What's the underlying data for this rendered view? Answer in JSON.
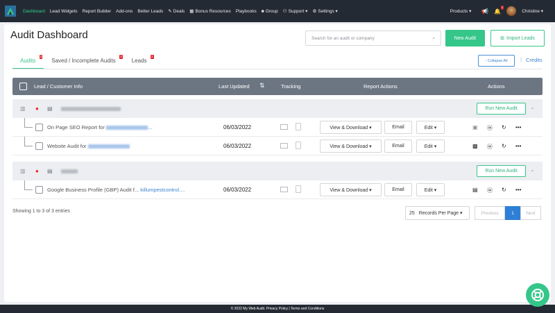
{
  "nav": {
    "items": [
      {
        "label": "Dashboard",
        "active": true
      },
      {
        "label": "Lead Widgets"
      },
      {
        "label": "Report Builder"
      },
      {
        "label": "Add-ons"
      },
      {
        "label": "Better Leads"
      },
      {
        "label": "Deals",
        "icon": "deals-icon"
      },
      {
        "label": "Bonus Resources",
        "icon": "bonus-icon"
      },
      {
        "label": "Playbooks"
      },
      {
        "label": "Group",
        "icon": "facebook-icon"
      },
      {
        "label": "Support ▾",
        "icon": "support-icon"
      },
      {
        "label": "Settings ▾",
        "icon": "gear-icon"
      }
    ],
    "products": "Products ▾",
    "notifications_count": "2",
    "user": "Christine ▾"
  },
  "page": {
    "title": "Audit Dashboard",
    "search_placeholder": "Search for an audit or company",
    "new_audit": "New Audit",
    "import_leads": "Import Leads",
    "collapse_all": "- Collapse All",
    "separator": "|",
    "credits": "Credits"
  },
  "tabs": [
    {
      "label": "Audits",
      "count": "3",
      "active": true
    },
    {
      "label": "Saved / Incomplete Audits",
      "count": "3"
    },
    {
      "label": "Leads",
      "count": "2"
    }
  ],
  "table": {
    "headers": {
      "info": "Lead / Customer Info",
      "updated": "Last Updated",
      "tracking": "Tracking",
      "report_actions": "Report Actions",
      "actions": "Actions"
    },
    "run_new_audit": "Run New Audit",
    "view_download": "View & Download ▾",
    "email": "Email",
    "edit": "Edit ▾",
    "rows": [
      {
        "name": "On Page SEO Report for",
        "link": "",
        "date": "06/03/2022"
      },
      {
        "name": "Website Audit for",
        "link": "",
        "date": "06/03/2022"
      },
      {
        "name": "Google Business Profile (GBP) Audit f...",
        "link": "killumpestcontrol....",
        "date": "06/03/2022"
      }
    ]
  },
  "footer": {
    "entries": "Showing 1 to 3 of 3 entries",
    "per_page_value": "25",
    "per_page_label": "Records Per Page ▾",
    "previous": "Previous",
    "page": "1",
    "next": "Next",
    "copyright": "© 2022 My Web Audit. Privacy Policy | Terms and Conditions"
  },
  "colors": {
    "accent": "#35c68a",
    "nav_bg": "#242a33",
    "header_bg": "#6c7683",
    "link": "#3d84d1"
  }
}
